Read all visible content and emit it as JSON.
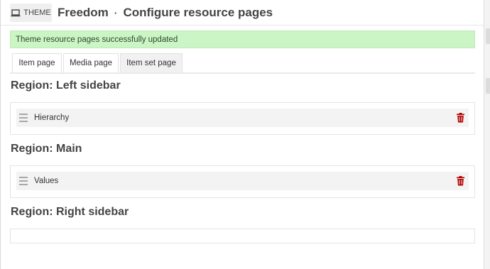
{
  "header": {
    "badge_label": "THEME",
    "badge_icon": "laptop-icon",
    "theme_name": "Freedom",
    "separator": "·",
    "page_title": "Configure resource pages"
  },
  "flash": {
    "message": "Theme resource pages successfully updated",
    "color": "#ccf5c6"
  },
  "tabs": [
    {
      "label": "Item page",
      "active": false
    },
    {
      "label": "Media page",
      "active": false
    },
    {
      "label": "Item set page",
      "active": true
    }
  ],
  "regions": [
    {
      "title": "Region: Left sidebar",
      "blocks": [
        {
          "label": "Hierarchy"
        }
      ]
    },
    {
      "title": "Region: Main",
      "blocks": [
        {
          "label": "Values"
        }
      ]
    },
    {
      "title": "Region: Right sidebar",
      "blocks": []
    }
  ],
  "colors": {
    "delete": "#b40000",
    "block_bg": "#f3f3f3"
  }
}
